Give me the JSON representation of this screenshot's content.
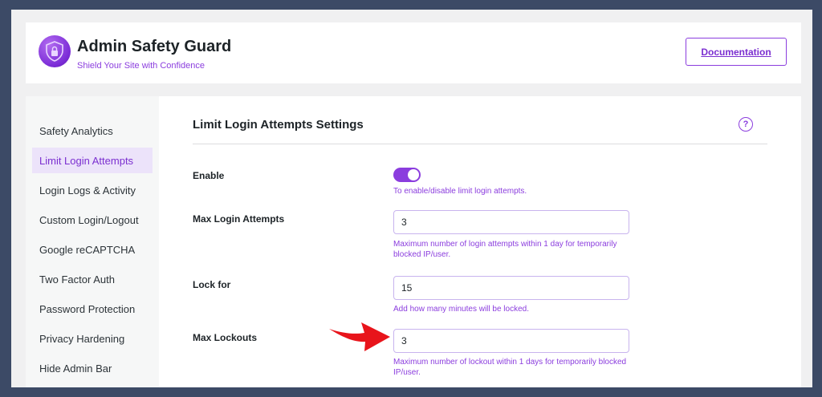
{
  "header": {
    "title": "Admin Safety Guard",
    "subtitle": "Shield Your Site with Confidence",
    "documentation_label": "Documentation",
    "logo_icon": "shield-lock-icon"
  },
  "sidebar": {
    "items": [
      {
        "label": "Safety Analytics",
        "active": false
      },
      {
        "label": "Limit Login Attempts",
        "active": true
      },
      {
        "label": "Login Logs & Activity",
        "active": false
      },
      {
        "label": "Custom Login/Logout",
        "active": false
      },
      {
        "label": "Google reCAPTCHA",
        "active": false
      },
      {
        "label": "Two Factor Auth",
        "active": false
      },
      {
        "label": "Password Protection",
        "active": false
      },
      {
        "label": "Privacy Hardening",
        "active": false
      },
      {
        "label": "Hide Admin Bar",
        "active": false
      }
    ]
  },
  "main": {
    "title": "Limit Login Attempts Settings",
    "help_glyph": "?",
    "enable": {
      "label": "Enable",
      "on": true,
      "hint": "To enable/disable limit login attempts."
    },
    "max_login_attempts": {
      "label": "Max Login Attempts",
      "value": "3",
      "hint": "Maximum number of login attempts within 1 day for temporarily blocked IP/user."
    },
    "lock_for": {
      "label": "Lock for",
      "value": "15",
      "hint": "Add how many minutes will be locked."
    },
    "max_lockouts": {
      "label": "Max Lockouts",
      "value": "3",
      "hint": "Maximum number of lockout within 1 days for temporarily blocked IP/user."
    }
  },
  "colors": {
    "accent": "#8b3dde",
    "background": "#3c4a66",
    "arrow": "#e8141b"
  }
}
